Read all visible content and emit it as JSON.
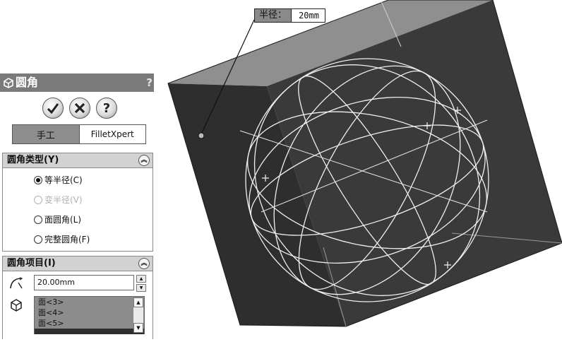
{
  "feature_panel": {
    "title": "圆角",
    "help_glyph": "?",
    "actions": {
      "ok_icon": "check-icon",
      "cancel_icon": "x-icon",
      "help_label": "?"
    },
    "tabs": [
      {
        "label": "手工",
        "active": true
      },
      {
        "label": "FilletXpert",
        "active": false
      }
    ],
    "fillet_type": {
      "header": "圆角类型(Y)",
      "options": [
        {
          "label": "等半径(C)",
          "checked": true,
          "enabled": true
        },
        {
          "label": "变半径(V)",
          "checked": false,
          "enabled": false
        },
        {
          "label": "面圆角(L)",
          "checked": false,
          "enabled": true
        },
        {
          "label": "完整圆角(F)",
          "checked": false,
          "enabled": true
        }
      ]
    },
    "fillet_items": {
      "header": "圆角项目(I)",
      "radius_value": "20.00mm",
      "faces": [
        "面<3>",
        "面<4>",
        "面<5>"
      ]
    }
  },
  "viewport": {
    "callout_label": "半径：",
    "callout_value": "20mm",
    "colors": {
      "top_face": "#8f8f8f",
      "front_face": "#2e2e2e",
      "right_face": "#3a3a3a",
      "wire": "#f0f0f0"
    }
  }
}
